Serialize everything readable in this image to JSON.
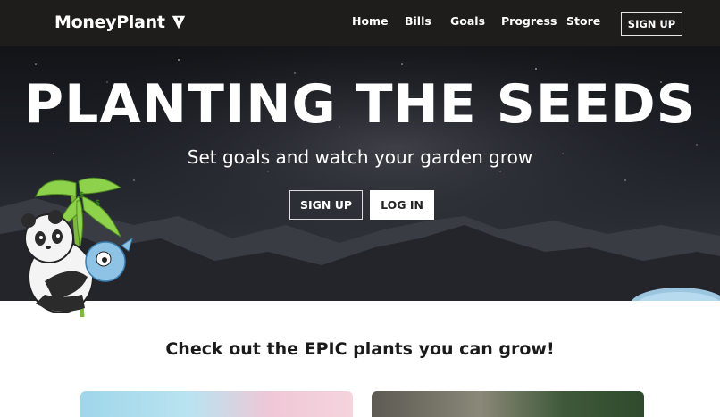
{
  "brand": {
    "name": "MoneyPlant",
    "logo_icon": "v-shield-logo"
  },
  "nav": {
    "links": [
      "Home",
      "Bills",
      "Goals",
      "Progress",
      "Store"
    ],
    "signup_label": "SIGN UP"
  },
  "hero": {
    "title": "PLANTING THE SEEDS",
    "subtitle": "Set goals and watch your garden grow",
    "signup_label": "SIGN UP",
    "login_label": "LOG IN"
  },
  "section": {
    "title": "Check out the EPIC plants you can grow!"
  },
  "colors": {
    "navbar_bg": "#1e1d1c",
    "hero_bg": "#1d2026",
    "text_light": "#ffffff",
    "text_dark": "#1a1a1a"
  }
}
